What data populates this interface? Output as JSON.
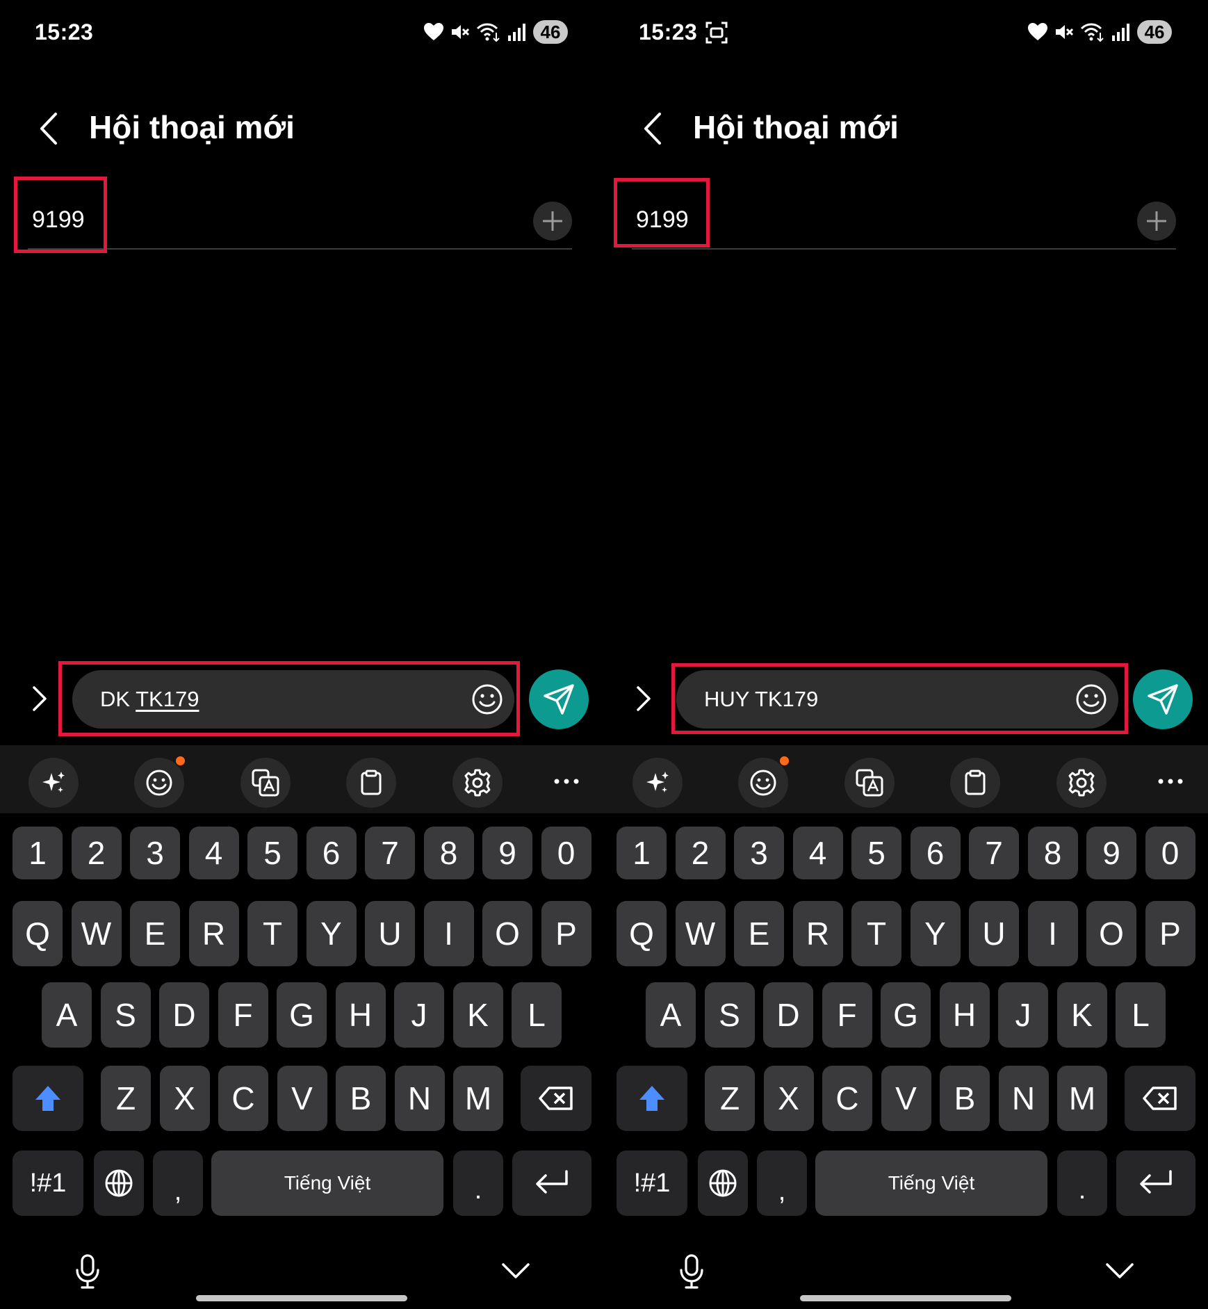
{
  "colors": {
    "highlight": "#e2183d",
    "send": "#0d9b91",
    "key": "#3a3a3c",
    "notify_dot": "#ff6a1a"
  },
  "screens": [
    {
      "status": {
        "time": "15:23",
        "battery": "46",
        "icons": [
          "heart-icon",
          "mute-icon",
          "wifi-icon",
          "signal-icon"
        ]
      },
      "header": {
        "back": "back-icon",
        "title": "Hội thoại mới"
      },
      "recipient": {
        "number": "9199"
      },
      "composer": {
        "text_plain": "DK ",
        "text_underlined": "TK179"
      }
    },
    {
      "status": {
        "time": "15:23",
        "battery": "46",
        "icons": [
          "screen-record-icon",
          "heart-icon",
          "mute-icon",
          "wifi-icon",
          "signal-icon"
        ]
      },
      "header": {
        "back": "back-icon",
        "title": "Hội thoại mới"
      },
      "recipient": {
        "number": "9199"
      },
      "composer": {
        "text_plain": "HUY TK179",
        "text_underlined": ""
      }
    }
  ],
  "keyboard": {
    "toolbar": [
      "ai-sparkle-icon",
      "emoji-icon",
      "translate-icon",
      "clipboard-icon",
      "settings-icon",
      "more-icon"
    ],
    "row_numbers": [
      "1",
      "2",
      "3",
      "4",
      "5",
      "6",
      "7",
      "8",
      "9",
      "0"
    ],
    "row_top": [
      "Q",
      "W",
      "E",
      "R",
      "T",
      "Y",
      "U",
      "I",
      "O",
      "P"
    ],
    "row_mid": [
      "A",
      "S",
      "D",
      "F",
      "G",
      "H",
      "J",
      "K",
      "L"
    ],
    "row_bottom": [
      "Z",
      "X",
      "C",
      "V",
      "B",
      "N",
      "M"
    ],
    "symbols_label": "!#1",
    "comma_label": ",",
    "space_label": "Tiếng Việt",
    "period_label": "."
  }
}
